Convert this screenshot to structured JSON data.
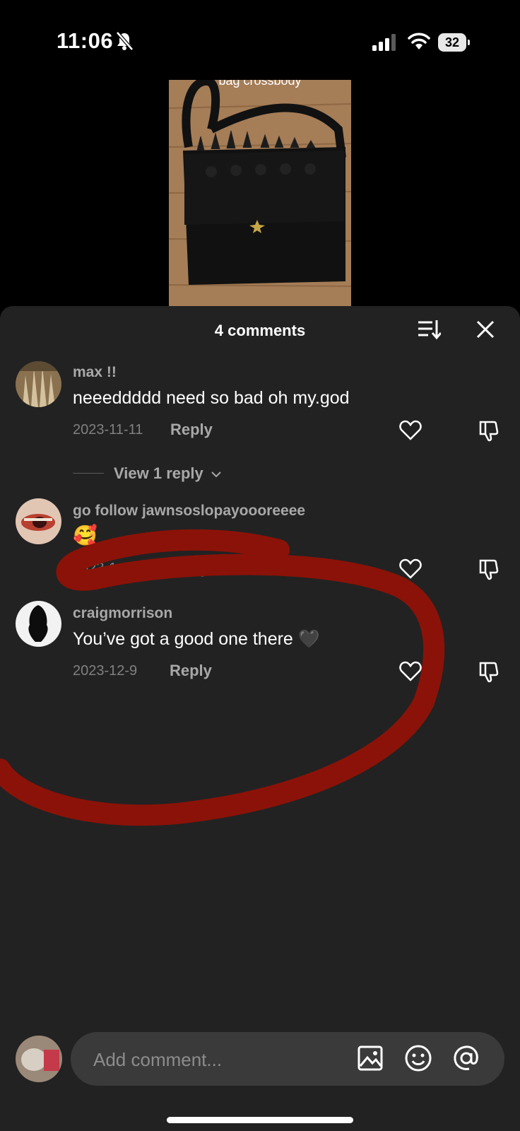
{
  "status_bar": {
    "time": "11:06",
    "battery": "32"
  },
  "video": {
    "caption": "bag crossbody"
  },
  "sheet": {
    "title": "4 comments"
  },
  "comments": [
    {
      "username": "max !!",
      "text": "neeeddddd need so bad oh my.god",
      "date": "2023-11-11",
      "reply": "Reply",
      "view_replies": "View 1 reply"
    },
    {
      "username": "go follow jawnsoslopayoooreeee",
      "text": "🥰",
      "date": "2023-1",
      "reply": "Reply"
    },
    {
      "username": "craigmorrison",
      "text": "You’ve got a good one there 🖤",
      "date": "2023-12-9",
      "reply": "Reply"
    }
  ],
  "composer": {
    "placeholder": "Add comment..."
  },
  "colors": {
    "sheet_bg": "#222222",
    "annotation": "#8b1208",
    "muted_text": "#a8a8a8"
  }
}
